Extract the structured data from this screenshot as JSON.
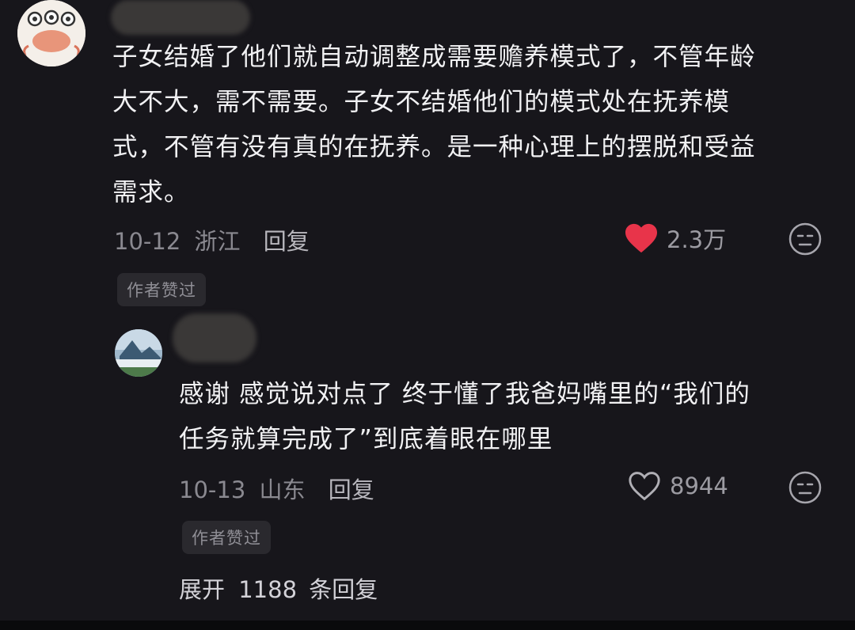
{
  "comment": {
    "text": "子女结婚了他们就自动调整成需要赡养模式了，不管年龄\n大不大，需不需要。子女不结婚他们的模式处在抚养模\n式，不管有没有真的在抚养。是一种心理上的摆脱和受益\n需求。",
    "date": "10-12",
    "location": "浙江",
    "reply_label": "回复",
    "likes": "2.3万",
    "liked": true,
    "badge": "作者赞过"
  },
  "reply": {
    "text": "感谢 感觉说对点了 终于懂了我爸妈嘴里的“我们的\n任务就算完成了”到底着眼在哪里",
    "date": "10-13",
    "location": "山东",
    "reply_label": "回复",
    "likes": "8944",
    "liked": false,
    "badge": "作者赞过"
  },
  "expand": {
    "prefix": "展开",
    "count": "1188",
    "suffix": "条回复"
  },
  "colors": {
    "background": "#17161b",
    "heart_red": "#e8344a",
    "text": "#f1f1f3",
    "meta": "#8a8990"
  },
  "icons": {
    "like_filled": "heart-filled-icon",
    "like_outline": "heart-outline-icon",
    "emoji": "face-emoji-icon"
  }
}
